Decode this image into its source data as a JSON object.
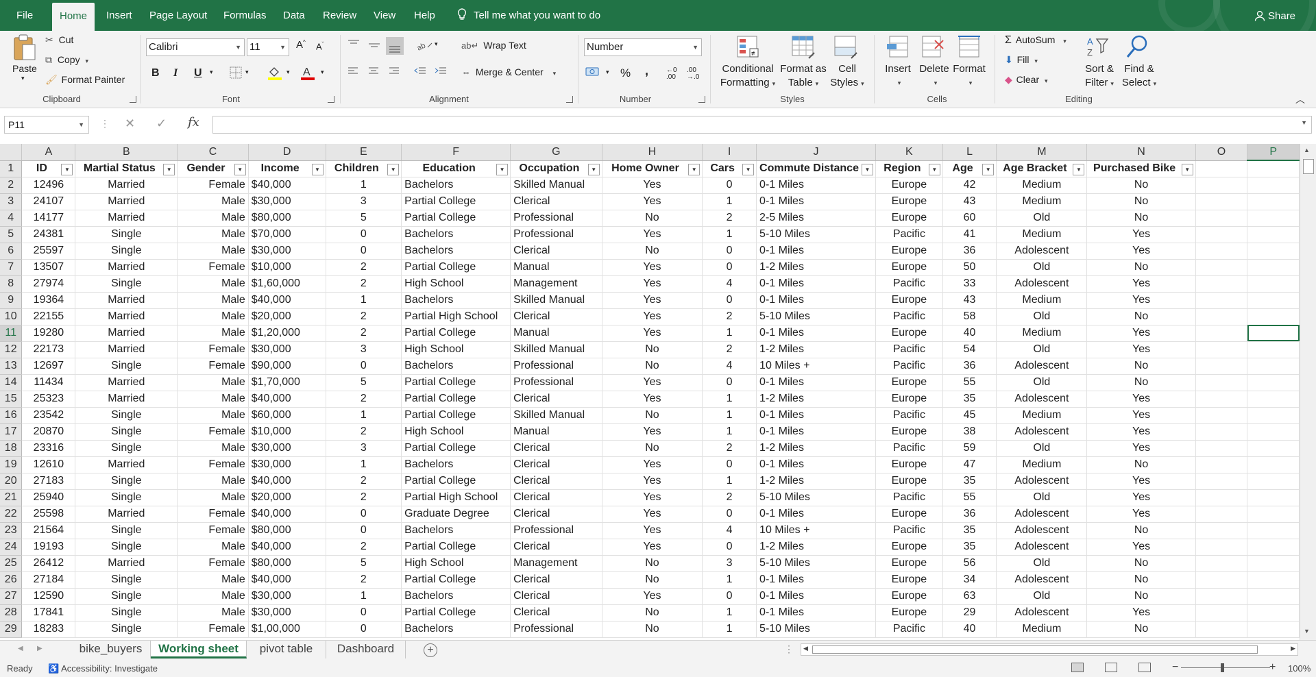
{
  "menu": {
    "file": "File",
    "tabs": [
      "Home",
      "Insert",
      "Page Layout",
      "Formulas",
      "Data",
      "Review",
      "View",
      "Help"
    ],
    "active_tab": "Home",
    "tell_me": "Tell me what you want to do",
    "share": "Share"
  },
  "ribbon": {
    "clipboard": {
      "label": "Clipboard",
      "paste": "Paste",
      "cut": "Cut",
      "copy": "Copy",
      "format_painter": "Format Painter"
    },
    "font": {
      "label": "Font",
      "name": "Calibri",
      "size": "11",
      "bold": "B",
      "italic": "I",
      "underline": "U"
    },
    "alignment": {
      "label": "Alignment",
      "wrap_text": "Wrap Text",
      "merge_center": "Merge & Center"
    },
    "number": {
      "label": "Number",
      "format": "Number",
      "percent": "%",
      "comma": ","
    },
    "styles": {
      "label": "Styles",
      "conditional_formatting": [
        "Conditional",
        "Formatting"
      ],
      "format_as_table": [
        "Format as",
        "Table"
      ],
      "cell_styles": [
        "Cell",
        "Styles"
      ]
    },
    "cells": {
      "label": "Cells",
      "insert": "Insert",
      "delete": "Delete",
      "format": "Format"
    },
    "editing": {
      "label": "Editing",
      "autosum": "AutoSum",
      "fill": "Fill",
      "clear": "Clear",
      "sort_filter": [
        "Sort &",
        "Filter"
      ],
      "find_select": [
        "Find &",
        "Select"
      ]
    }
  },
  "formula_bar": {
    "name_box": "P11",
    "fx": "fx",
    "value": ""
  },
  "sheet": {
    "columns": [
      "A",
      "B",
      "C",
      "D",
      "E",
      "F",
      "G",
      "H",
      "I",
      "J",
      "K",
      "L",
      "M",
      "N",
      "O",
      "P"
    ],
    "selected_column": "P",
    "selected_row": 11,
    "headers": [
      "ID",
      "Martial Status",
      "Gender",
      "Income",
      "Children",
      "Education",
      "Occupation",
      "Home Owner",
      "Cars",
      "Commute Distance",
      "Region",
      "Age",
      "Age Bracket",
      "Purchased Bike"
    ],
    "rows": [
      [
        "12496",
        "Married",
        "Female",
        "$40,000",
        "1",
        "Bachelors",
        "Skilled Manual",
        "Yes",
        "0",
        "0-1 Miles",
        "Europe",
        "42",
        "Medium",
        "No"
      ],
      [
        "24107",
        "Married",
        "Male",
        "$30,000",
        "3",
        "Partial College",
        "Clerical",
        "Yes",
        "1",
        "0-1 Miles",
        "Europe",
        "43",
        "Medium",
        "No"
      ],
      [
        "14177",
        "Married",
        "Male",
        "$80,000",
        "5",
        "Partial College",
        "Professional",
        "No",
        "2",
        "2-5 Miles",
        "Europe",
        "60",
        "Old",
        "No"
      ],
      [
        "24381",
        "Single",
        "Male",
        "$70,000",
        "0",
        "Bachelors",
        "Professional",
        "Yes",
        "1",
        "5-10 Miles",
        "Pacific",
        "41",
        "Medium",
        "Yes"
      ],
      [
        "25597",
        "Single",
        "Male",
        "$30,000",
        "0",
        "Bachelors",
        "Clerical",
        "No",
        "0",
        "0-1 Miles",
        "Europe",
        "36",
        "Adolescent",
        "Yes"
      ],
      [
        "13507",
        "Married",
        "Female",
        "$10,000",
        "2",
        "Partial College",
        "Manual",
        "Yes",
        "0",
        "1-2 Miles",
        "Europe",
        "50",
        "Old",
        "No"
      ],
      [
        "27974",
        "Single",
        "Male",
        "$1,60,000",
        "2",
        "High School",
        "Management",
        "Yes",
        "4",
        "0-1 Miles",
        "Pacific",
        "33",
        "Adolescent",
        "Yes"
      ],
      [
        "19364",
        "Married",
        "Male",
        "$40,000",
        "1",
        "Bachelors",
        "Skilled Manual",
        "Yes",
        "0",
        "0-1 Miles",
        "Europe",
        "43",
        "Medium",
        "Yes"
      ],
      [
        "22155",
        "Married",
        "Male",
        "$20,000",
        "2",
        "Partial High School",
        "Clerical",
        "Yes",
        "2",
        "5-10 Miles",
        "Pacific",
        "58",
        "Old",
        "No"
      ],
      [
        "19280",
        "Married",
        "Male",
        "$1,20,000",
        "2",
        "Partial College",
        "Manual",
        "Yes",
        "1",
        "0-1 Miles",
        "Europe",
        "40",
        "Medium",
        "Yes"
      ],
      [
        "22173",
        "Married",
        "Female",
        "$30,000",
        "3",
        "High School",
        "Skilled Manual",
        "No",
        "2",
        "1-2 Miles",
        "Pacific",
        "54",
        "Old",
        "Yes"
      ],
      [
        "12697",
        "Single",
        "Female",
        "$90,000",
        "0",
        "Bachelors",
        "Professional",
        "No",
        "4",
        "10 Miles +",
        "Pacific",
        "36",
        "Adolescent",
        "No"
      ],
      [
        "11434",
        "Married",
        "Male",
        "$1,70,000",
        "5",
        "Partial College",
        "Professional",
        "Yes",
        "0",
        "0-1 Miles",
        "Europe",
        "55",
        "Old",
        "No"
      ],
      [
        "25323",
        "Married",
        "Male",
        "$40,000",
        "2",
        "Partial College",
        "Clerical",
        "Yes",
        "1",
        "1-2 Miles",
        "Europe",
        "35",
        "Adolescent",
        "Yes"
      ],
      [
        "23542",
        "Single",
        "Male",
        "$60,000",
        "1",
        "Partial College",
        "Skilled Manual",
        "No",
        "1",
        "0-1 Miles",
        "Pacific",
        "45",
        "Medium",
        "Yes"
      ],
      [
        "20870",
        "Single",
        "Female",
        "$10,000",
        "2",
        "High School",
        "Manual",
        "Yes",
        "1",
        "0-1 Miles",
        "Europe",
        "38",
        "Adolescent",
        "Yes"
      ],
      [
        "23316",
        "Single",
        "Male",
        "$30,000",
        "3",
        "Partial College",
        "Clerical",
        "No",
        "2",
        "1-2 Miles",
        "Pacific",
        "59",
        "Old",
        "Yes"
      ],
      [
        "12610",
        "Married",
        "Female",
        "$30,000",
        "1",
        "Bachelors",
        "Clerical",
        "Yes",
        "0",
        "0-1 Miles",
        "Europe",
        "47",
        "Medium",
        "No"
      ],
      [
        "27183",
        "Single",
        "Male",
        "$40,000",
        "2",
        "Partial College",
        "Clerical",
        "Yes",
        "1",
        "1-2 Miles",
        "Europe",
        "35",
        "Adolescent",
        "Yes"
      ],
      [
        "25940",
        "Single",
        "Male",
        "$20,000",
        "2",
        "Partial High School",
        "Clerical",
        "Yes",
        "2",
        "5-10 Miles",
        "Pacific",
        "55",
        "Old",
        "Yes"
      ],
      [
        "25598",
        "Married",
        "Female",
        "$40,000",
        "0",
        "Graduate Degree",
        "Clerical",
        "Yes",
        "0",
        "0-1 Miles",
        "Europe",
        "36",
        "Adolescent",
        "Yes"
      ],
      [
        "21564",
        "Single",
        "Female",
        "$80,000",
        "0",
        "Bachelors",
        "Professional",
        "Yes",
        "4",
        "10 Miles +",
        "Pacific",
        "35",
        "Adolescent",
        "No"
      ],
      [
        "19193",
        "Single",
        "Male",
        "$40,000",
        "2",
        "Partial College",
        "Clerical",
        "Yes",
        "0",
        "1-2 Miles",
        "Europe",
        "35",
        "Adolescent",
        "Yes"
      ],
      [
        "26412",
        "Married",
        "Female",
        "$80,000",
        "5",
        "High School",
        "Management",
        "No",
        "3",
        "5-10 Miles",
        "Europe",
        "56",
        "Old",
        "No"
      ],
      [
        "27184",
        "Single",
        "Male",
        "$40,000",
        "2",
        "Partial College",
        "Clerical",
        "No",
        "1",
        "0-1 Miles",
        "Europe",
        "34",
        "Adolescent",
        "No"
      ],
      [
        "12590",
        "Single",
        "Male",
        "$30,000",
        "1",
        "Bachelors",
        "Clerical",
        "Yes",
        "0",
        "0-1 Miles",
        "Europe",
        "63",
        "Old",
        "No"
      ],
      [
        "17841",
        "Single",
        "Male",
        "$30,000",
        "0",
        "Partial College",
        "Clerical",
        "No",
        "1",
        "0-1 Miles",
        "Europe",
        "29",
        "Adolescent",
        "Yes"
      ],
      [
        "18283",
        "Single",
        "Female",
        "$1,00,000",
        "0",
        "Bachelors",
        "Professional",
        "No",
        "1",
        "5-10 Miles",
        "Pacific",
        "40",
        "Medium",
        "No"
      ]
    ]
  },
  "sheet_tabs": {
    "tabs": [
      "bike_buyers",
      "Working sheet",
      "pivot table",
      "Dashboard"
    ],
    "active": "Working sheet"
  },
  "status": {
    "ready": "Ready",
    "accessibility": "Accessibility: Investigate",
    "zoom": "100%"
  },
  "colors": {
    "accent": "#217346"
  }
}
